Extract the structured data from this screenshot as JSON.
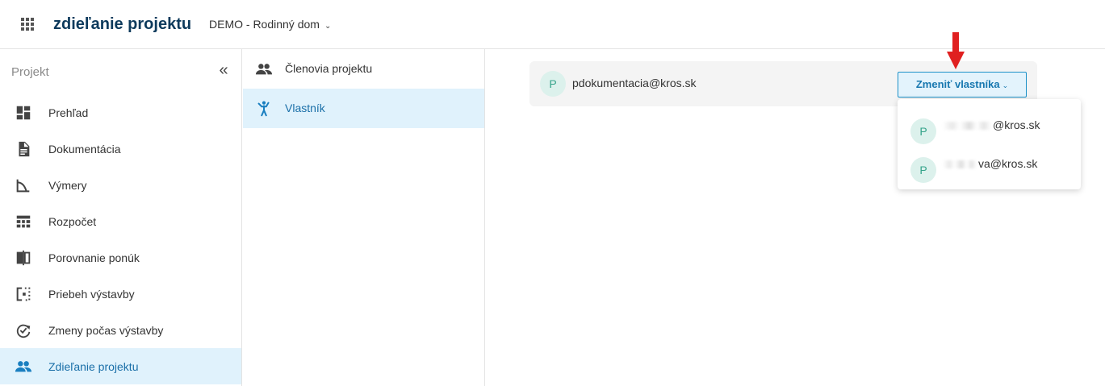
{
  "header": {
    "app_title": "zdieľanie projektu",
    "project_name": "DEMO - Rodinný dom"
  },
  "sidebar": {
    "title": "Projekt",
    "items": [
      {
        "label": "Prehľad",
        "icon": "dashboard-icon"
      },
      {
        "label": "Dokumentácia",
        "icon": "document-icon"
      },
      {
        "label": "Výmery",
        "icon": "measure-icon"
      },
      {
        "label": "Rozpočet",
        "icon": "budget-table-icon"
      },
      {
        "label": "Porovnanie ponúk",
        "icon": "compare-icon"
      },
      {
        "label": "Priebeh výstavby",
        "icon": "progress-icon"
      },
      {
        "label": "Zmeny počas výstavby",
        "icon": "changes-cycle-icon"
      },
      {
        "label": "Zdieľanie projektu",
        "icon": "people-icon",
        "active": true
      }
    ]
  },
  "subnav": {
    "items": [
      {
        "label": "Členovia projektu",
        "icon": "people-icon"
      },
      {
        "label": "Vlastník",
        "icon": "person-waving-icon",
        "active": true
      }
    ]
  },
  "owner": {
    "avatar_letter": "P",
    "email": "pdokumentacia@kros.sk",
    "change_button_label": "Zmeniť vlastníka"
  },
  "dropdown": {
    "items": [
      {
        "avatar_letter": "P",
        "email_visible": "@kros.sk"
      },
      {
        "avatar_letter": "P",
        "email_visible": "va@kros.sk"
      }
    ]
  },
  "colors": {
    "accent": "#1a90c8",
    "active_bg": "#e0f2fc",
    "title": "#0d3a5c",
    "avatar_bg": "#dcf1ec",
    "avatar_text": "#35a38a",
    "arrow": "#e02020"
  }
}
